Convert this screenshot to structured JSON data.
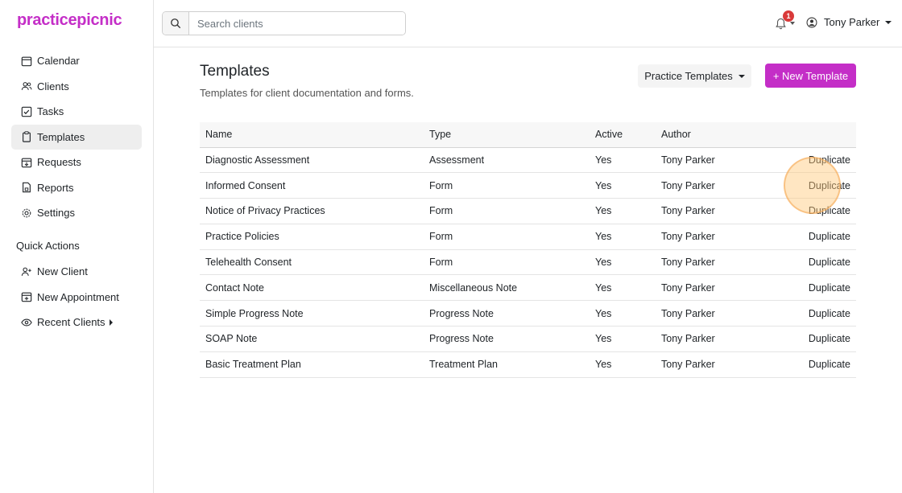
{
  "brand": {
    "logo": "practicepicnic",
    "accent": "#c42ec7"
  },
  "sidebar": {
    "items": [
      {
        "label": "Calendar",
        "icon": "calendar-icon"
      },
      {
        "label": "Clients",
        "icon": "users-icon"
      },
      {
        "label": "Tasks",
        "icon": "checkbox-icon"
      },
      {
        "label": "Templates",
        "icon": "clipboard-icon",
        "active": true
      },
      {
        "label": "Requests",
        "icon": "inbox-icon"
      },
      {
        "label": "Reports",
        "icon": "document-icon"
      },
      {
        "label": "Settings",
        "icon": "gear-icon"
      }
    ],
    "quick_actions_title": "Quick Actions",
    "quick_actions": [
      {
        "label": "New Client",
        "icon": "user-plus-icon"
      },
      {
        "label": "New Appointment",
        "icon": "calendar-plus-icon"
      },
      {
        "label": "Recent Clients",
        "icon": "eye-icon"
      }
    ]
  },
  "topbar": {
    "search_placeholder": "Search clients",
    "notification_count": "1",
    "user_name": "Tony Parker"
  },
  "main": {
    "title": "Templates",
    "subtitle": "Templates for client documentation and forms.",
    "filter_label": "Practice Templates",
    "new_button_label": "+ New Template",
    "columns": [
      "Name",
      "Type",
      "Active",
      "Author",
      ""
    ],
    "rows": [
      {
        "name": "Diagnostic Assessment",
        "type": "Assessment",
        "active": "Yes",
        "author": "Tony Parker",
        "action": "Duplicate"
      },
      {
        "name": "Informed Consent",
        "type": "Form",
        "active": "Yes",
        "author": "Tony Parker",
        "action": "Duplicate"
      },
      {
        "name": "Notice of Privacy Practices",
        "type": "Form",
        "active": "Yes",
        "author": "Tony Parker",
        "action": "Duplicate"
      },
      {
        "name": "Practice Policies",
        "type": "Form",
        "active": "Yes",
        "author": "Tony Parker",
        "action": "Duplicate"
      },
      {
        "name": "Telehealth Consent",
        "type": "Form",
        "active": "Yes",
        "author": "Tony Parker",
        "action": "Duplicate"
      },
      {
        "name": "Contact Note",
        "type": "Miscellaneous Note",
        "active": "Yes",
        "author": "Tony Parker",
        "action": "Duplicate"
      },
      {
        "name": "Simple Progress Note",
        "type": "Progress Note",
        "active": "Yes",
        "author": "Tony Parker",
        "action": "Duplicate"
      },
      {
        "name": "SOAP Note",
        "type": "Progress Note",
        "active": "Yes",
        "author": "Tony Parker",
        "action": "Duplicate"
      },
      {
        "name": "Basic Treatment Plan",
        "type": "Treatment Plan",
        "active": "Yes",
        "author": "Tony Parker",
        "action": "Duplicate"
      }
    ]
  }
}
